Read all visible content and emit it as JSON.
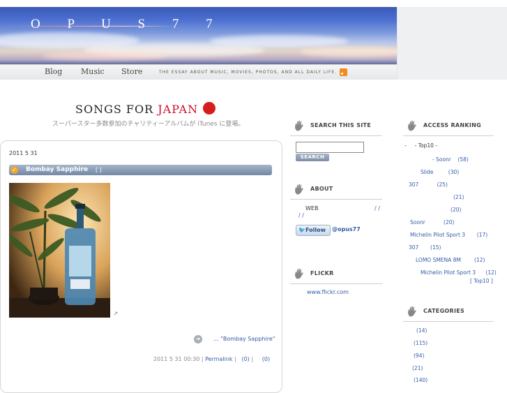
{
  "header": {
    "logo": "O P U S 7 7",
    "nav": [
      "Blog",
      "Music",
      "Store"
    ],
    "tagline": "THE ESSAY ABOUT MUSIC, MOVIES, PHOTOS, AND ALL DAILY LIFE."
  },
  "banner": {
    "title_a": "SONGS FOR ",
    "title_b": "JAPAN",
    "subtitle": "スーパースター多数参加のチャリティーアルバムが iTunes に登場。"
  },
  "post": {
    "date": "2011 5 31",
    "title": "Bombay Sapphire",
    "category": "[ ]",
    "more_link": "... \"Bombay Sapphire\"",
    "meta_time": "2011 5 31 00:30 |",
    "permalink": "Permalink",
    "comments": "(0)",
    "trackbacks": "(0)",
    "sep": "|"
  },
  "search": {
    "heading": "SEARCH THIS SITE",
    "button": "SEARCH",
    "placeholder": ""
  },
  "about": {
    "heading": "ABOUT",
    "line1": "WEB",
    "line1_suffix": "/ /",
    "line2": "/ /",
    "follow_button": "Follow",
    "follow_handle": "@opus77"
  },
  "flickr": {
    "heading": "FLICKR",
    "link": "www.flickr.com"
  },
  "ranking": {
    "heading": "ACCESS RANKING",
    "intro": "- Top10 -",
    "items": [
      {
        "label": "- Soonr",
        "count": "(58)"
      },
      {
        "label": "Slide",
        "count": "(30)"
      },
      {
        "label": "307",
        "count": "(25)"
      },
      {
        "label": "",
        "count": "(21)"
      },
      {
        "label": "",
        "count": "(20)"
      },
      {
        "label": "Soonr",
        "count": "(20)"
      },
      {
        "label": "Michelin Pilot Sport 3",
        "count": "(17)"
      },
      {
        "label": "307",
        "count": "(15)"
      },
      {
        "label": "LOMO SMENA 8M",
        "count": "(12)"
      },
      {
        "label": "Michelin Pilot Sport 3",
        "count": "(12)"
      }
    ],
    "more": "[ Top10 ]"
  },
  "categories": {
    "heading": "CATEGORIES",
    "items": [
      "(14)",
      "(115)",
      "(94)",
      "(21)",
      "(140)"
    ]
  }
}
